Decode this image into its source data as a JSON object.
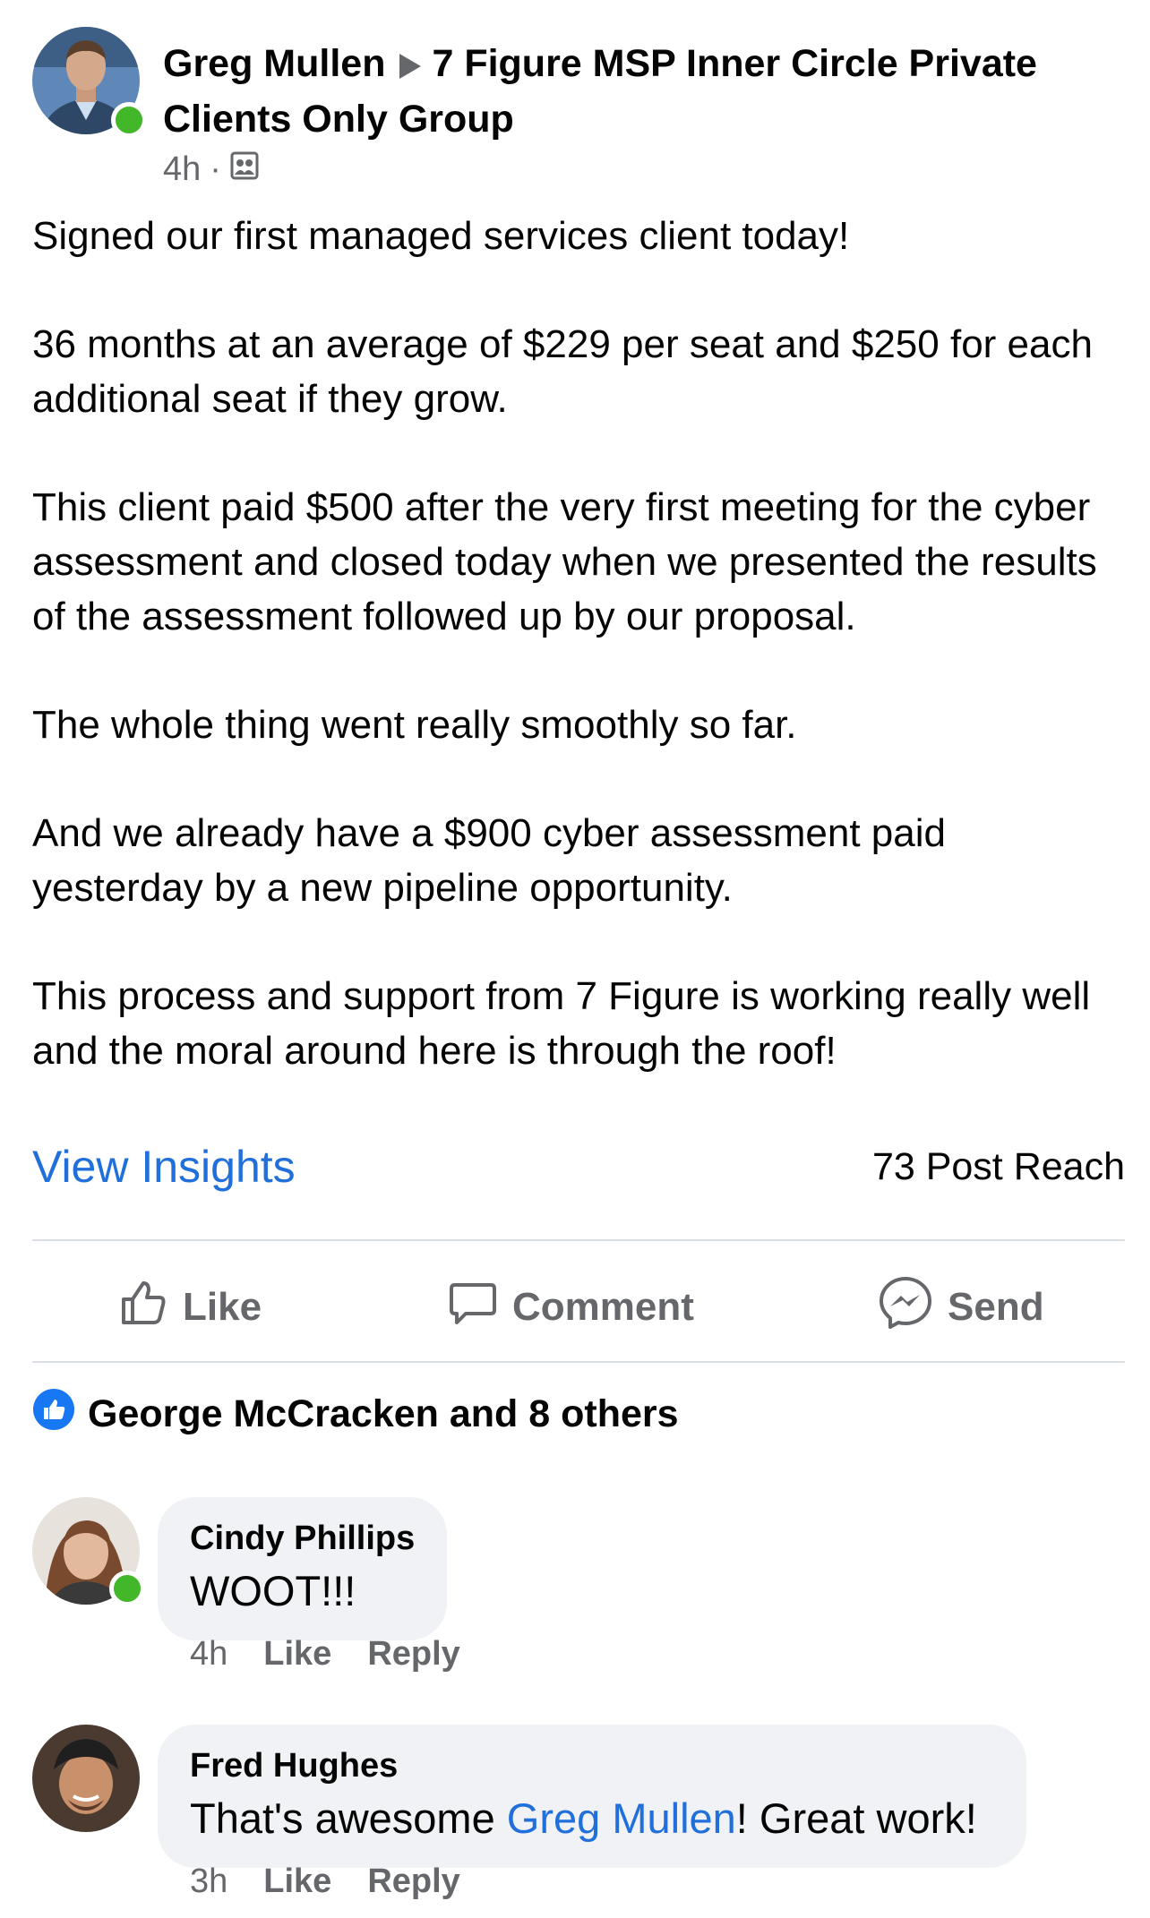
{
  "post": {
    "author": "Greg Mullen",
    "group": "7 Figure MSP Inner Circle Private Clients Only Group",
    "time": "4h",
    "separator": "·",
    "audience_icon": "group-icon",
    "paragraphs": [
      "Signed our first managed services client today!",
      "36 months at an average of $229 per seat and $250 for each additional seat if they grow.",
      "This client paid $500 after the very first meeting for the cyber assessment and closed today when we presented the results of the assessment followed up by our proposal.",
      "The whole thing went really smoothly so far.",
      "And we already have a $900 cyber assessment paid yesterday by a new pipeline opportunity.",
      "This process and support from 7 Figure is working really well and the moral around here is through the roof!"
    ],
    "view_insights": "View Insights",
    "post_reach": "73 Post Reach"
  },
  "actions": {
    "like": "Like",
    "comment": "Comment",
    "send": "Send"
  },
  "reactions": {
    "summary": "George McCracken and 8 others"
  },
  "comments": [
    {
      "name": "Cindy Phillips",
      "text": "WOOT!!!",
      "time": "4h",
      "like": "Like",
      "reply": "Reply"
    },
    {
      "name": "Fred Hughes",
      "text_before": "That's awesome ",
      "mention": "Greg Mullen",
      "text_after": "! Great work!",
      "time": "3h",
      "like": "Like",
      "reply": "Reply"
    }
  ],
  "colors": {
    "accent": "#216fdb",
    "online": "#42b72a",
    "muted": "#65676b",
    "bubble": "#f0f2f5"
  }
}
